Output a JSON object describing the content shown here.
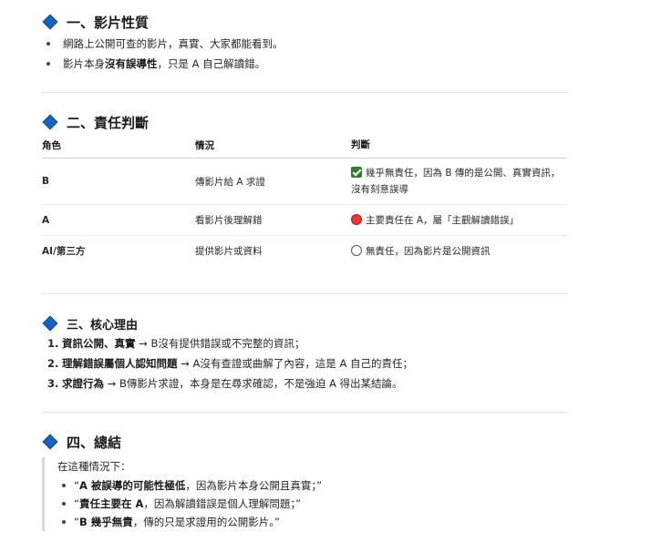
{
  "sections": [
    {
      "title": "一、影片性質",
      "bullets": [
        {
          "parts": [
            {
              "text": "網路上公開可查的影片，真實、大家都能看到。",
              "bold": false
            }
          ]
        },
        {
          "parts": [
            {
              "text": "影片本身",
              "bold": false
            },
            {
              "text": "沒有誤導性",
              "bold": true
            },
            {
              "text": "，只是 A 自己解讀錯。",
              "bold": false
            }
          ]
        }
      ]
    },
    {
      "title": "二、責任判斷",
      "table": {
        "headers": [
          "角色",
          "情況",
          "判斷"
        ],
        "rows": [
          {
            "role": "B",
            "situation": "傳影片給 A 求證",
            "icon": "green-check-icon",
            "judgment": "幾乎無責任，因為 B 傳的是公開、真實資訊，沒有刻意誤導"
          },
          {
            "role": "A",
            "situation": "看影片後理解錯",
            "icon": "red-circle-icon",
            "judgment": "主要責任在 A，屬「主觀解讀錯誤」"
          },
          {
            "role": "AI/第三方",
            "situation": "提供影片或資料",
            "icon": "white-circle-icon",
            "judgment": "無責任，因為影片是公開資訊"
          }
        ]
      }
    },
    {
      "title": "三、核心理由",
      "items": [
        {
          "num": "1.",
          "bold": "資訊公開、真實",
          "rest": " → B沒有提供錯誤或不完整的資訊；"
        },
        {
          "num": "2.",
          "bold": "理解錯誤屬個人認知問題",
          "rest": " → A沒有查證或曲解了內容，這是 A 自己的責任；"
        },
        {
          "num": "3.",
          "bold": "求證行為",
          "rest": " → B傳影片求證，本身是在尋求確認，不是強迫 A 得出某結論。"
        }
      ]
    },
    {
      "title": "四、總結",
      "intro": "在這種情況下：",
      "quotes": [
        {
          "pre": "“",
          "bold": "A 被誤導的可能性極低",
          "rest": "，因為影片本身公開且真實；”"
        },
        {
          "pre": "“",
          "bold": "責任主要在 A",
          "rest": "，因為解讀錯誤是個人理解問題；”"
        },
        {
          "pre": "“",
          "bold": "B 幾乎無責",
          "rest": "，傳的只是求證用的公開影片。”"
        }
      ]
    }
  ],
  "colors": {
    "diamond": "#1565c0",
    "check": "#2e7d32",
    "red": "#e53935"
  }
}
